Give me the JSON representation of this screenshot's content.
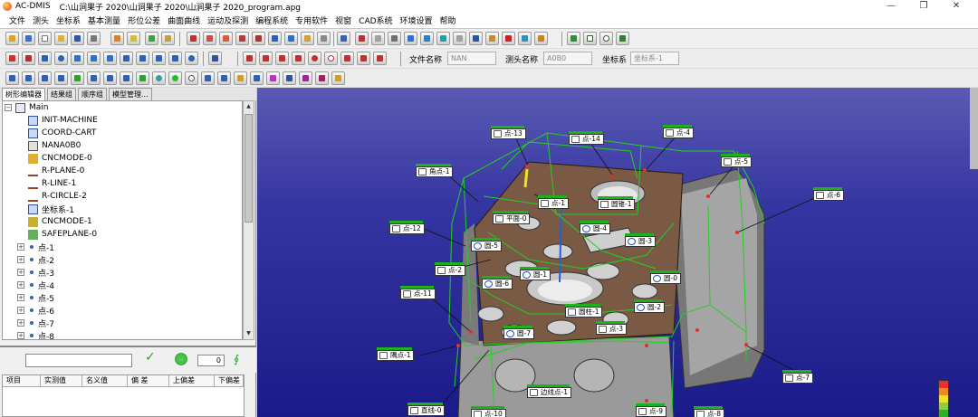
{
  "title": {
    "app": "AC-DMIS",
    "path": "C:\\山涧果子 2020\\山涧果子 2020\\山涧果子 2020_program.apg"
  },
  "window_buttons": {
    "minimize": "—",
    "maximize": "❐",
    "close": "✕"
  },
  "menu": [
    "文件",
    "测头",
    "坐标系",
    "基本测量",
    "形位公差",
    "曲面曲线",
    "运动及探测",
    "编程系统",
    "专用软件",
    "视窗",
    "CAD系统",
    "环境设置",
    "帮助"
  ],
  "toolbar": {
    "file_name_label": "文件名称",
    "file_name_value": "NAN",
    "probe_name_label": "测头名称",
    "probe_name_value": "A0B0",
    "coord_label": "坐标系",
    "coord_value": "坐标系-1"
  },
  "tabs": [
    "树形编辑器",
    "结果组",
    "顺序组",
    "模型管理..."
  ],
  "tree": {
    "root": "Main",
    "children": [
      "INIT-MACHINE",
      "COORD-CART",
      "NANA0B0",
      "CNCMODE-0",
      "R-PLANE-0",
      "R-LINE-1",
      "R-CIRCLE-2",
      "坐标系-1",
      "CNCMODE-1",
      "SAFEPLANE-0"
    ],
    "points": [
      "点-1",
      "点-2",
      "点-3",
      "点-4",
      "点-5",
      "点-6",
      "点-7",
      "点-8"
    ]
  },
  "lower": {
    "count": "0"
  },
  "results_headers": [
    "项目",
    "实测值",
    "名义值",
    "偏 差",
    "上偏差",
    "下偏差"
  ],
  "viewport": {
    "tags": [
      "点-13",
      "点-14",
      "点-4",
      "点-5",
      "角点-1",
      "点-1",
      "圆锥-1",
      "点-6",
      "平面-0",
      "圆-4",
      "点-12",
      "圆-5",
      "圆-3",
      "点-2",
      "圆-1",
      "圆-6",
      "圆-0",
      "点-11",
      "圆柱-1",
      "圆-2",
      "点-3",
      "圆-7",
      "隅点-1",
      "点-7",
      "边线点-1",
      "直线-0",
      "点-10",
      "点-9",
      "点-8"
    ],
    "legend_colors": [
      "#e8312a",
      "#f08a20",
      "#f2e020",
      "#8ad040",
      "#2ab02a"
    ]
  }
}
